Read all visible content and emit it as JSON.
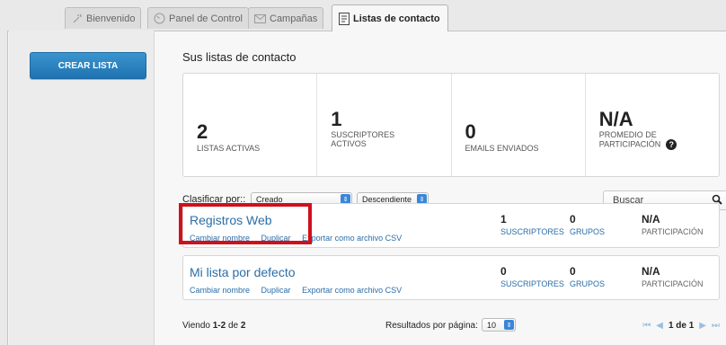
{
  "tabs": [
    {
      "label": "Bienvenido",
      "icon": "sparkle-icon"
    },
    {
      "label": "Panel de Control",
      "icon": "gauge-icon"
    },
    {
      "label": "Campañas",
      "icon": "envelope-icon"
    },
    {
      "label": "Listas de contacto",
      "icon": "list-icon",
      "active": true
    }
  ],
  "sidebar": {
    "create_button": "CREAR LISTA"
  },
  "main": {
    "title": "Sus listas de contacto",
    "stats": [
      {
        "value": "2",
        "label": "LISTAS ACTIVAS"
      },
      {
        "value": "1",
        "label": "SUSCRIPTORES ACTIVOS"
      },
      {
        "value": "0",
        "label": "EMAILS ENVIADOS"
      },
      {
        "value": "N/A",
        "label": "PROMEDIO DE PARTICIPACIÓN"
      }
    ],
    "sort": {
      "label": "Clasificar por::",
      "field": "Creado",
      "order": "Descendiente"
    },
    "search_placeholder": "Buscar",
    "lists": [
      {
        "name": "Registros Web",
        "actions": [
          "Cambiar nombre",
          "Duplicar",
          "Exportar como archivo CSV"
        ],
        "subscribers": "1",
        "subscribers_label": "SUSCRIPTORES",
        "groups": "0",
        "groups_label": "GRUPOS",
        "participation": "N/A",
        "participation_label": "PARTICIPACIÓN"
      },
      {
        "name": "Mi lista por defecto",
        "actions": [
          "Cambiar nombre",
          "Duplicar",
          "Exportar como archivo CSV"
        ],
        "subscribers": "0",
        "subscribers_label": "SUSCRIPTORES",
        "groups": "0",
        "groups_label": "GRUPOS",
        "participation": "N/A",
        "participation_label": "PARTICIPACIÓN"
      }
    ],
    "footer": {
      "viewing_prefix": "Viendo",
      "viewing_range": "1-2",
      "viewing_of": "de",
      "viewing_total": "2",
      "per_page_label": "Resultados por página:",
      "per_page": "10",
      "page_info": "1 de 1"
    }
  },
  "colors": {
    "accent": "#1f73b0",
    "link": "#2b6ea8",
    "highlight": "#d0101b"
  }
}
